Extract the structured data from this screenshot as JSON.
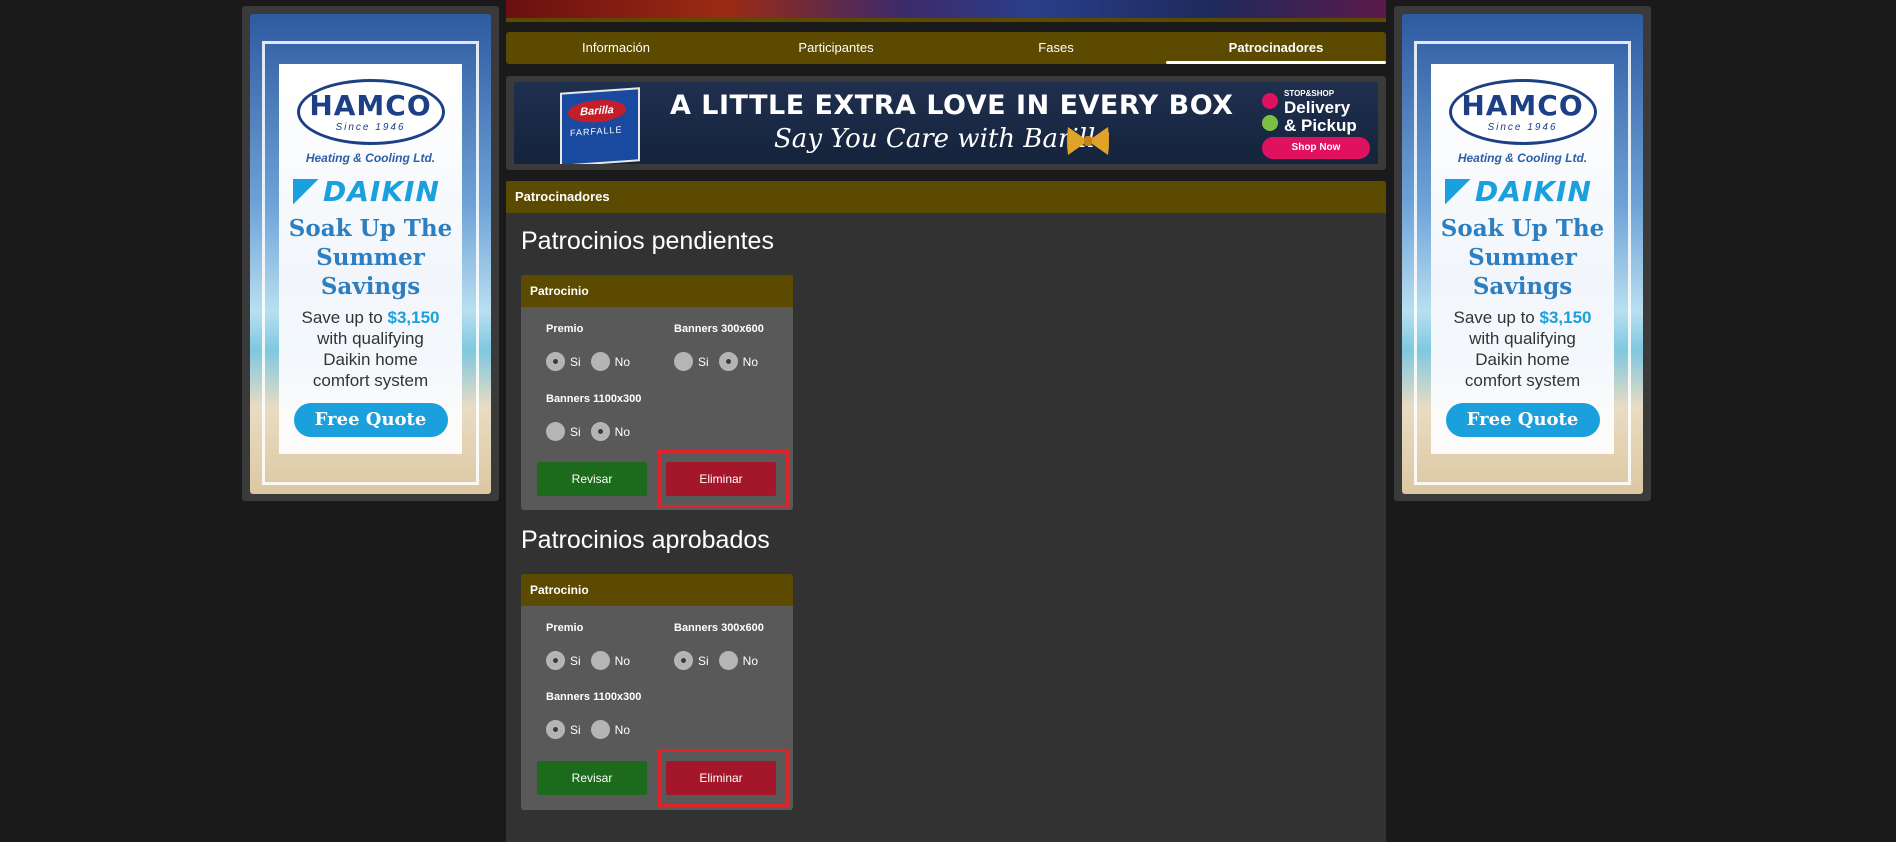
{
  "side_ad": {
    "brand": "HAMCO",
    "since": "Since 1946",
    "subtitle": "Heating & Cooling Ltd.",
    "partner": "DAIKIN",
    "headline_1": "Soak Up The",
    "headline_2": "Summer",
    "headline_3": "Savings",
    "save_prefix": "Save up to ",
    "save_amount": "$3,150",
    "body_1": "with qualifying",
    "body_2": "Daikin home",
    "body_3": "comfort system",
    "cta": "Free Quote"
  },
  "tabs": [
    {
      "label": "Información",
      "active": false
    },
    {
      "label": "Participantes",
      "active": false
    },
    {
      "label": "Fases",
      "active": false
    },
    {
      "label": "Patrocinadores",
      "active": true
    }
  ],
  "banner": {
    "pasta_brand": "Barilla",
    "pasta_name": "FARFALLE",
    "headline": "A LITTLE EXTRA LOVE IN EVERY BOX",
    "subline": "Say You Care with Barilla",
    "store": "STOP&SHOP",
    "service_1": "Delivery",
    "service_2": "& Pickup",
    "cta": "Shop Now"
  },
  "panel": {
    "title": "Patrocinadores",
    "pending_title": "Patrocinios pendientes",
    "approved_title": "Patrocinios aprobados"
  },
  "cards": [
    {
      "header": "Patrocinio",
      "fields": [
        {
          "label": "Premio",
          "yes": "Si",
          "no": "No",
          "selected": "Si"
        },
        {
          "label": "Banners 300x600",
          "yes": "Si",
          "no": "No",
          "selected": "No"
        },
        {
          "label": "Banners 1100x300",
          "yes": "Si",
          "no": "No",
          "selected": "No"
        }
      ],
      "review_label": "Revisar",
      "delete_label": "Eliminar"
    },
    {
      "header": "Patrocinio",
      "fields": [
        {
          "label": "Premio",
          "yes": "Si",
          "no": "No",
          "selected": "Si"
        },
        {
          "label": "Banners 300x600",
          "yes": "Si",
          "no": "No",
          "selected": "Si"
        },
        {
          "label": "Banners 1100x300",
          "yes": "Si",
          "no": "No",
          "selected": "Si"
        }
      ],
      "review_label": "Revisar",
      "delete_label": "Eliminar"
    }
  ],
  "colors": {
    "accent": "#5c4a00",
    "review": "#1c6b1c",
    "delete": "#a4162a",
    "highlight": "#e0222a"
  }
}
